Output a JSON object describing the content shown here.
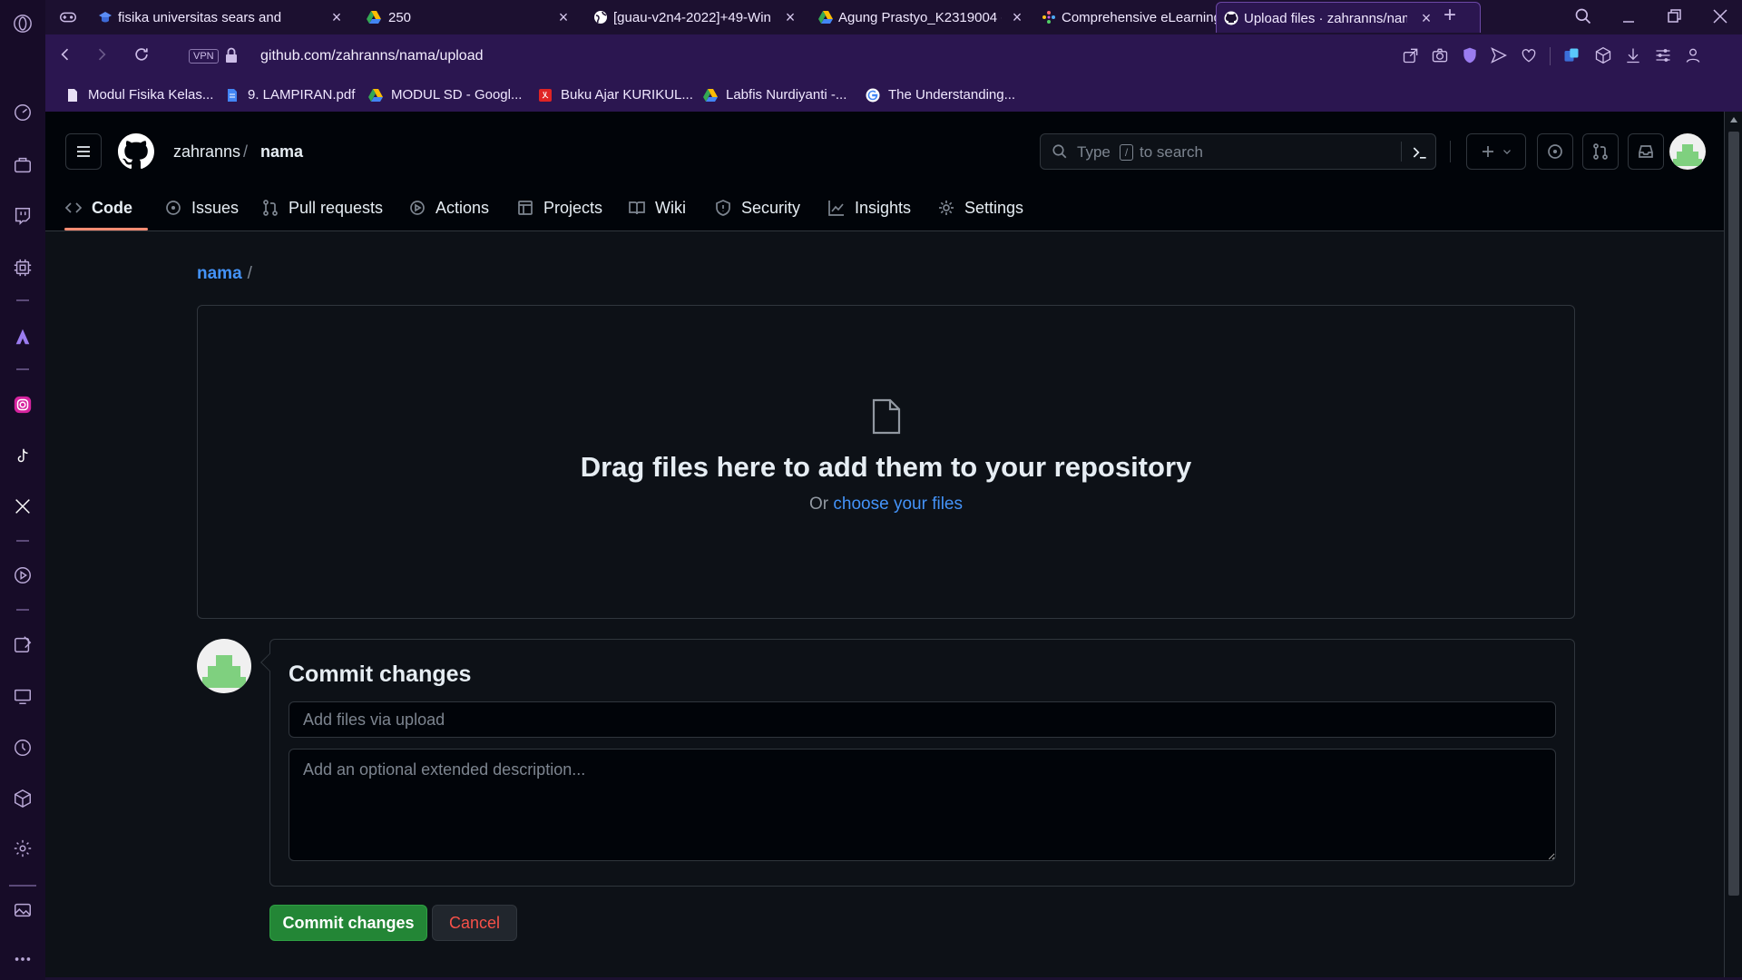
{
  "browser": {
    "tabs": [
      {
        "title": "fisika universitas sears and",
        "favicon": "graduation-cap-icon"
      },
      {
        "title": "250",
        "favicon": "google-drive-icon"
      },
      {
        "title": "[guau-v2n4-2022]+49-Win",
        "favicon": "globe-icon"
      },
      {
        "title": "Agung Prastyo_K2319004 -",
        "favicon": "google-drive-icon"
      },
      {
        "title": "Comprehensive eLearning",
        "favicon": "sparkle-icon"
      },
      {
        "title": "Upload files · zahranns/nam",
        "favicon": "github-icon",
        "active": true
      }
    ],
    "vpn_label": "VPN",
    "url": "github.com/zahranns/nama/upload",
    "bookmarks": [
      {
        "label": "Modul Fisika Kelas...",
        "icon": "file-icon"
      },
      {
        "label": "9. LAMPIRAN.pdf",
        "icon": "doc-icon"
      },
      {
        "label": "MODUL SD - Googl...",
        "icon": "google-drive-icon"
      },
      {
        "label": "Buku Ajar KURIKUL...",
        "icon": "pdf-icon"
      },
      {
        "label": "Labfis Nurdiyanti -...",
        "icon": "google-drive-icon"
      },
      {
        "label": "The Understanding...",
        "icon": "google-icon"
      }
    ]
  },
  "github": {
    "owner": "zahranns",
    "separator": "/",
    "repo": "nama",
    "search": {
      "prefix": "Type",
      "key": "/",
      "suffix": "to search"
    },
    "nav": [
      {
        "label": "Code",
        "icon": "code-icon",
        "active": true
      },
      {
        "label": "Issues",
        "icon": "issue-icon"
      },
      {
        "label": "Pull requests",
        "icon": "pull-request-icon"
      },
      {
        "label": "Actions",
        "icon": "play-icon"
      },
      {
        "label": "Projects",
        "icon": "table-icon"
      },
      {
        "label": "Wiki",
        "icon": "book-icon"
      },
      {
        "label": "Security",
        "icon": "shield-icon"
      },
      {
        "label": "Insights",
        "icon": "graph-icon"
      },
      {
        "label": "Settings",
        "icon": "gear-icon"
      }
    ]
  },
  "upload": {
    "breadcrumb_repo": "nama",
    "breadcrumb_sep": "/",
    "drop_title": "Drag files here to add them to your repository",
    "drop_or": "Or",
    "choose_link": "choose your files"
  },
  "commit": {
    "heading": "Commit changes",
    "summary_placeholder": "Add files via upload",
    "description_placeholder": "Add an optional extended description...",
    "commit_button": "Commit changes",
    "cancel_button": "Cancel"
  },
  "colors": {
    "accent_link": "#4493f8",
    "commit_green": "#238636",
    "cancel_red": "#f85149",
    "tab_underline": "#fd8c73",
    "browser_purple": "#2b1650"
  }
}
